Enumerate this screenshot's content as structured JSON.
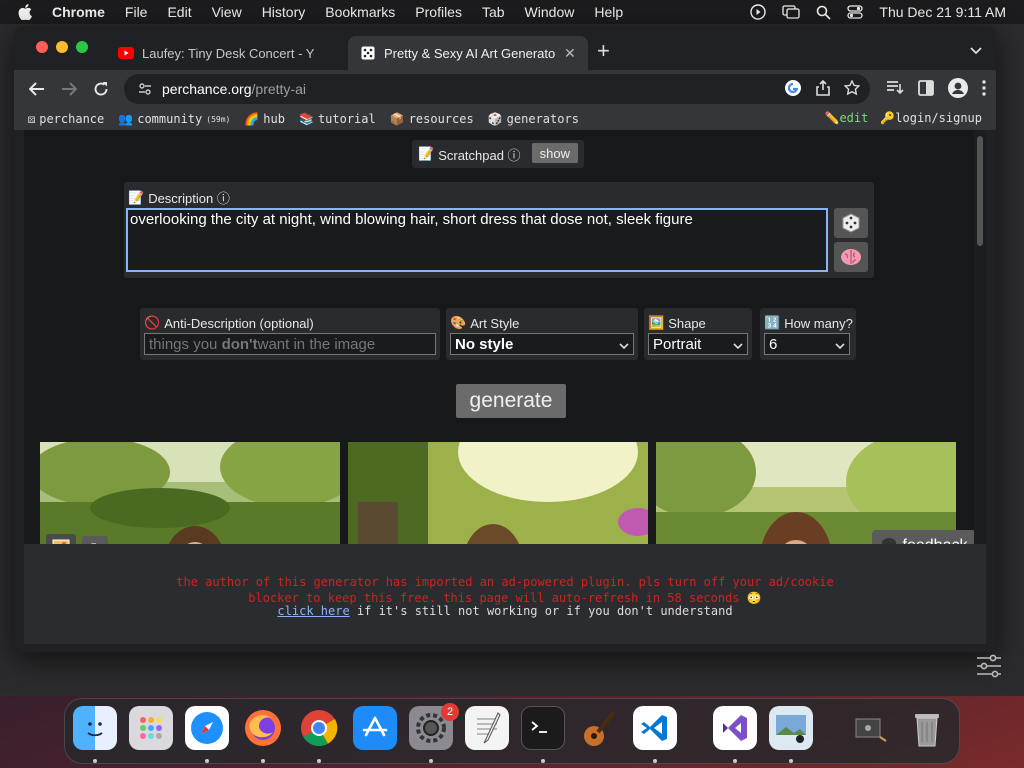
{
  "menubar": {
    "app": "Chrome",
    "items": [
      "File",
      "Edit",
      "View",
      "History",
      "Bookmarks",
      "Profiles",
      "Tab",
      "Window",
      "Help"
    ],
    "datetime": "Thu Dec 21  9:11 AM"
  },
  "tabs": [
    {
      "title": "Laufey: Tiny Desk Concert - Yo",
      "favicon": "youtube-icon",
      "active": false
    },
    {
      "title": "Pretty & Sexy AI Art Generator",
      "favicon": "perchance-dice-icon",
      "active": true
    }
  ],
  "omnibox": {
    "host": "perchance.org",
    "path": "/pretty-ai"
  },
  "bookmarks": {
    "items": [
      {
        "label": "perchance",
        "icon": "dice-icon"
      },
      {
        "label": "community",
        "extra": "(59m)",
        "icon": "people-icon"
      },
      {
        "label": "hub",
        "icon": "rainbow-icon"
      },
      {
        "label": "tutorial",
        "icon": "books-icon"
      },
      {
        "label": "resources",
        "icon": "box-icon"
      },
      {
        "label": "generators",
        "icon": "dice-icon"
      }
    ],
    "edit": "edit",
    "login": "login/signup"
  },
  "scratchpad": {
    "label": "Scratchpad ⓘ",
    "button": "show"
  },
  "description": {
    "label": "Description ⓘ",
    "value": "overlooking the city at night, wind blowing hair, short dress that dose not, sleek figure"
  },
  "anti_description": {
    "label": "Anti-Description (optional)",
    "placeholder_pre": "things you ",
    "placeholder_bold": "don't",
    "placeholder_post": " want in the image"
  },
  "art_style": {
    "label": "Art Style",
    "value": "No style"
  },
  "shape": {
    "label": "Shape",
    "value": "Portrait"
  },
  "how_many": {
    "label": "How many?",
    "value": "6"
  },
  "generate": "generate",
  "feedback": "feedback",
  "footer": {
    "line1": "the author of this generator has imported an ad-powered plugin. pls turn off your ad/cookie",
    "line2": "blocker to keep this free. this page will auto-refresh in 58 seconds 😳",
    "link": "click here",
    "line3_rest": " if it's still not working or if you don't understand"
  },
  "dock": {
    "apps": [
      "finder-icon",
      "launchpad-icon",
      "safari-icon",
      "firefox-icon",
      "chrome-icon",
      "app-store-icon",
      "system-settings-icon",
      "textedit-icon",
      "terminal-icon",
      "garageband-icon",
      "vscode-icon",
      "visual-studio-icon",
      "preview-icon",
      "screenshot-icon",
      "trash-icon"
    ],
    "settings_badge": "2"
  },
  "colors": {
    "accent": "#8ab4f8",
    "warning": "#d32020",
    "edit": "#7dd87d"
  }
}
